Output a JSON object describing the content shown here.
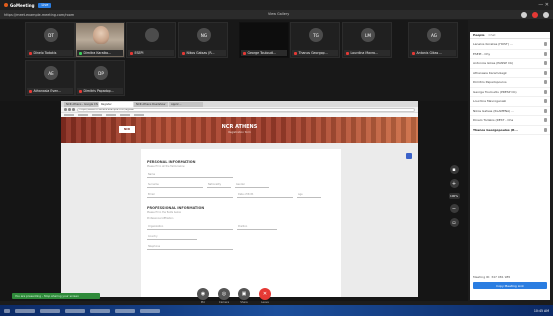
{
  "app": {
    "brand": "GoMeeting",
    "live_label": "Live"
  },
  "url": "https://meet.example-meeting.com/room",
  "view_toggle": "View Gallery",
  "strip": {
    "tiles": [
      {
        "initials": "DT",
        "name": "Dinelo Todakis",
        "mic": "off",
        "kind": "avatar"
      },
      {
        "initials": "",
        "name": "Dimitra Karaiko...",
        "mic": "on",
        "kind": "video"
      },
      {
        "initials": "",
        "name": "ESEPI",
        "mic": "off",
        "kind": "avatar"
      },
      {
        "initials": "NG",
        "name": "Nikos Gatsas (R...",
        "mic": "off",
        "kind": "avatar"
      },
      {
        "initials": "",
        "name": "George Touloudi...",
        "mic": "off",
        "kind": "active"
      },
      {
        "initials": "TG",
        "name": "Thanos Georgop...",
        "mic": "off",
        "kind": "avatar"
      },
      {
        "initials": "LM",
        "name": "Lourdina Mavro...",
        "mic": "off",
        "kind": "avatar"
      },
      {
        "initials": "AG",
        "name": "Antonis Gikas ...",
        "mic": "off",
        "kind": "avatar"
      },
      {
        "initials": "AE",
        "name": "Athanasia Even...",
        "mic": "off",
        "kind": "avatar"
      },
      {
        "initials": "DP",
        "name": "Dimitris Papadop...",
        "mic": "off",
        "kind": "avatar"
      }
    ]
  },
  "browser": {
    "tabs": [
      "NCR Athens - Google Chrome",
      "Register",
      "NCR Athens Roadshow",
      "Applic..."
    ],
    "address": "https://www.ncr-athens.example.com/register",
    "hero_logo": "NCR",
    "hero_title": "NCR ATHENS",
    "hero_sub": "Registration form",
    "form": {
      "section1_title": "PERSONAL INFORMATION",
      "section1_sub": "Please fill in all the fields below",
      "field_name": "Name",
      "field_surname": "Surname",
      "field_nationality": "Nationality",
      "field_gender": "Gender",
      "field_email": "Email",
      "field_date": "Date of Birth",
      "field_age": "Age",
      "section2_title": "PROFESSIONAL INFORMATION",
      "section2_sub": "Please fill in the fields below",
      "field_org_label": "Professional Affiliation",
      "field_org": "Organization",
      "field_position": "Position",
      "field_country": "Country",
      "field_phone": "Telephone"
    }
  },
  "tools": {
    "zoom": "100%"
  },
  "panel": {
    "tabs": [
      "People",
      "Chat"
    ],
    "participants": [
      "Lanelos Korakas (HOST) ...",
      "ESEPI - Chy",
      "Antonios Gikas (PANSP Cb)",
      "Athanasia Karamolegk",
      "Dimitris Papadopoulos",
      "George Touloudis (PRESP Cb)",
      "Lourdina Mavrogenaki",
      "Nikos Gatsas (RLAMENA) ...",
      "Dinelo Todakis (REST - Cha",
      "Thanos Georgopoulos (R..."
    ],
    "meeting_id": "Meeting ID: 347 081 985",
    "copy_label": "Copy Meeting Link"
  },
  "status_pill": "You are presenting - Stop sharing your screen",
  "controls": [
    {
      "label": "Mic",
      "glyph": "◉",
      "red": false
    },
    {
      "label": "Camera",
      "glyph": "◎",
      "red": false
    },
    {
      "label": "Share",
      "glyph": "▣",
      "red": false
    },
    {
      "label": "Leave",
      "glyph": "✕",
      "red": true
    }
  ],
  "clock": "10:45 AM"
}
